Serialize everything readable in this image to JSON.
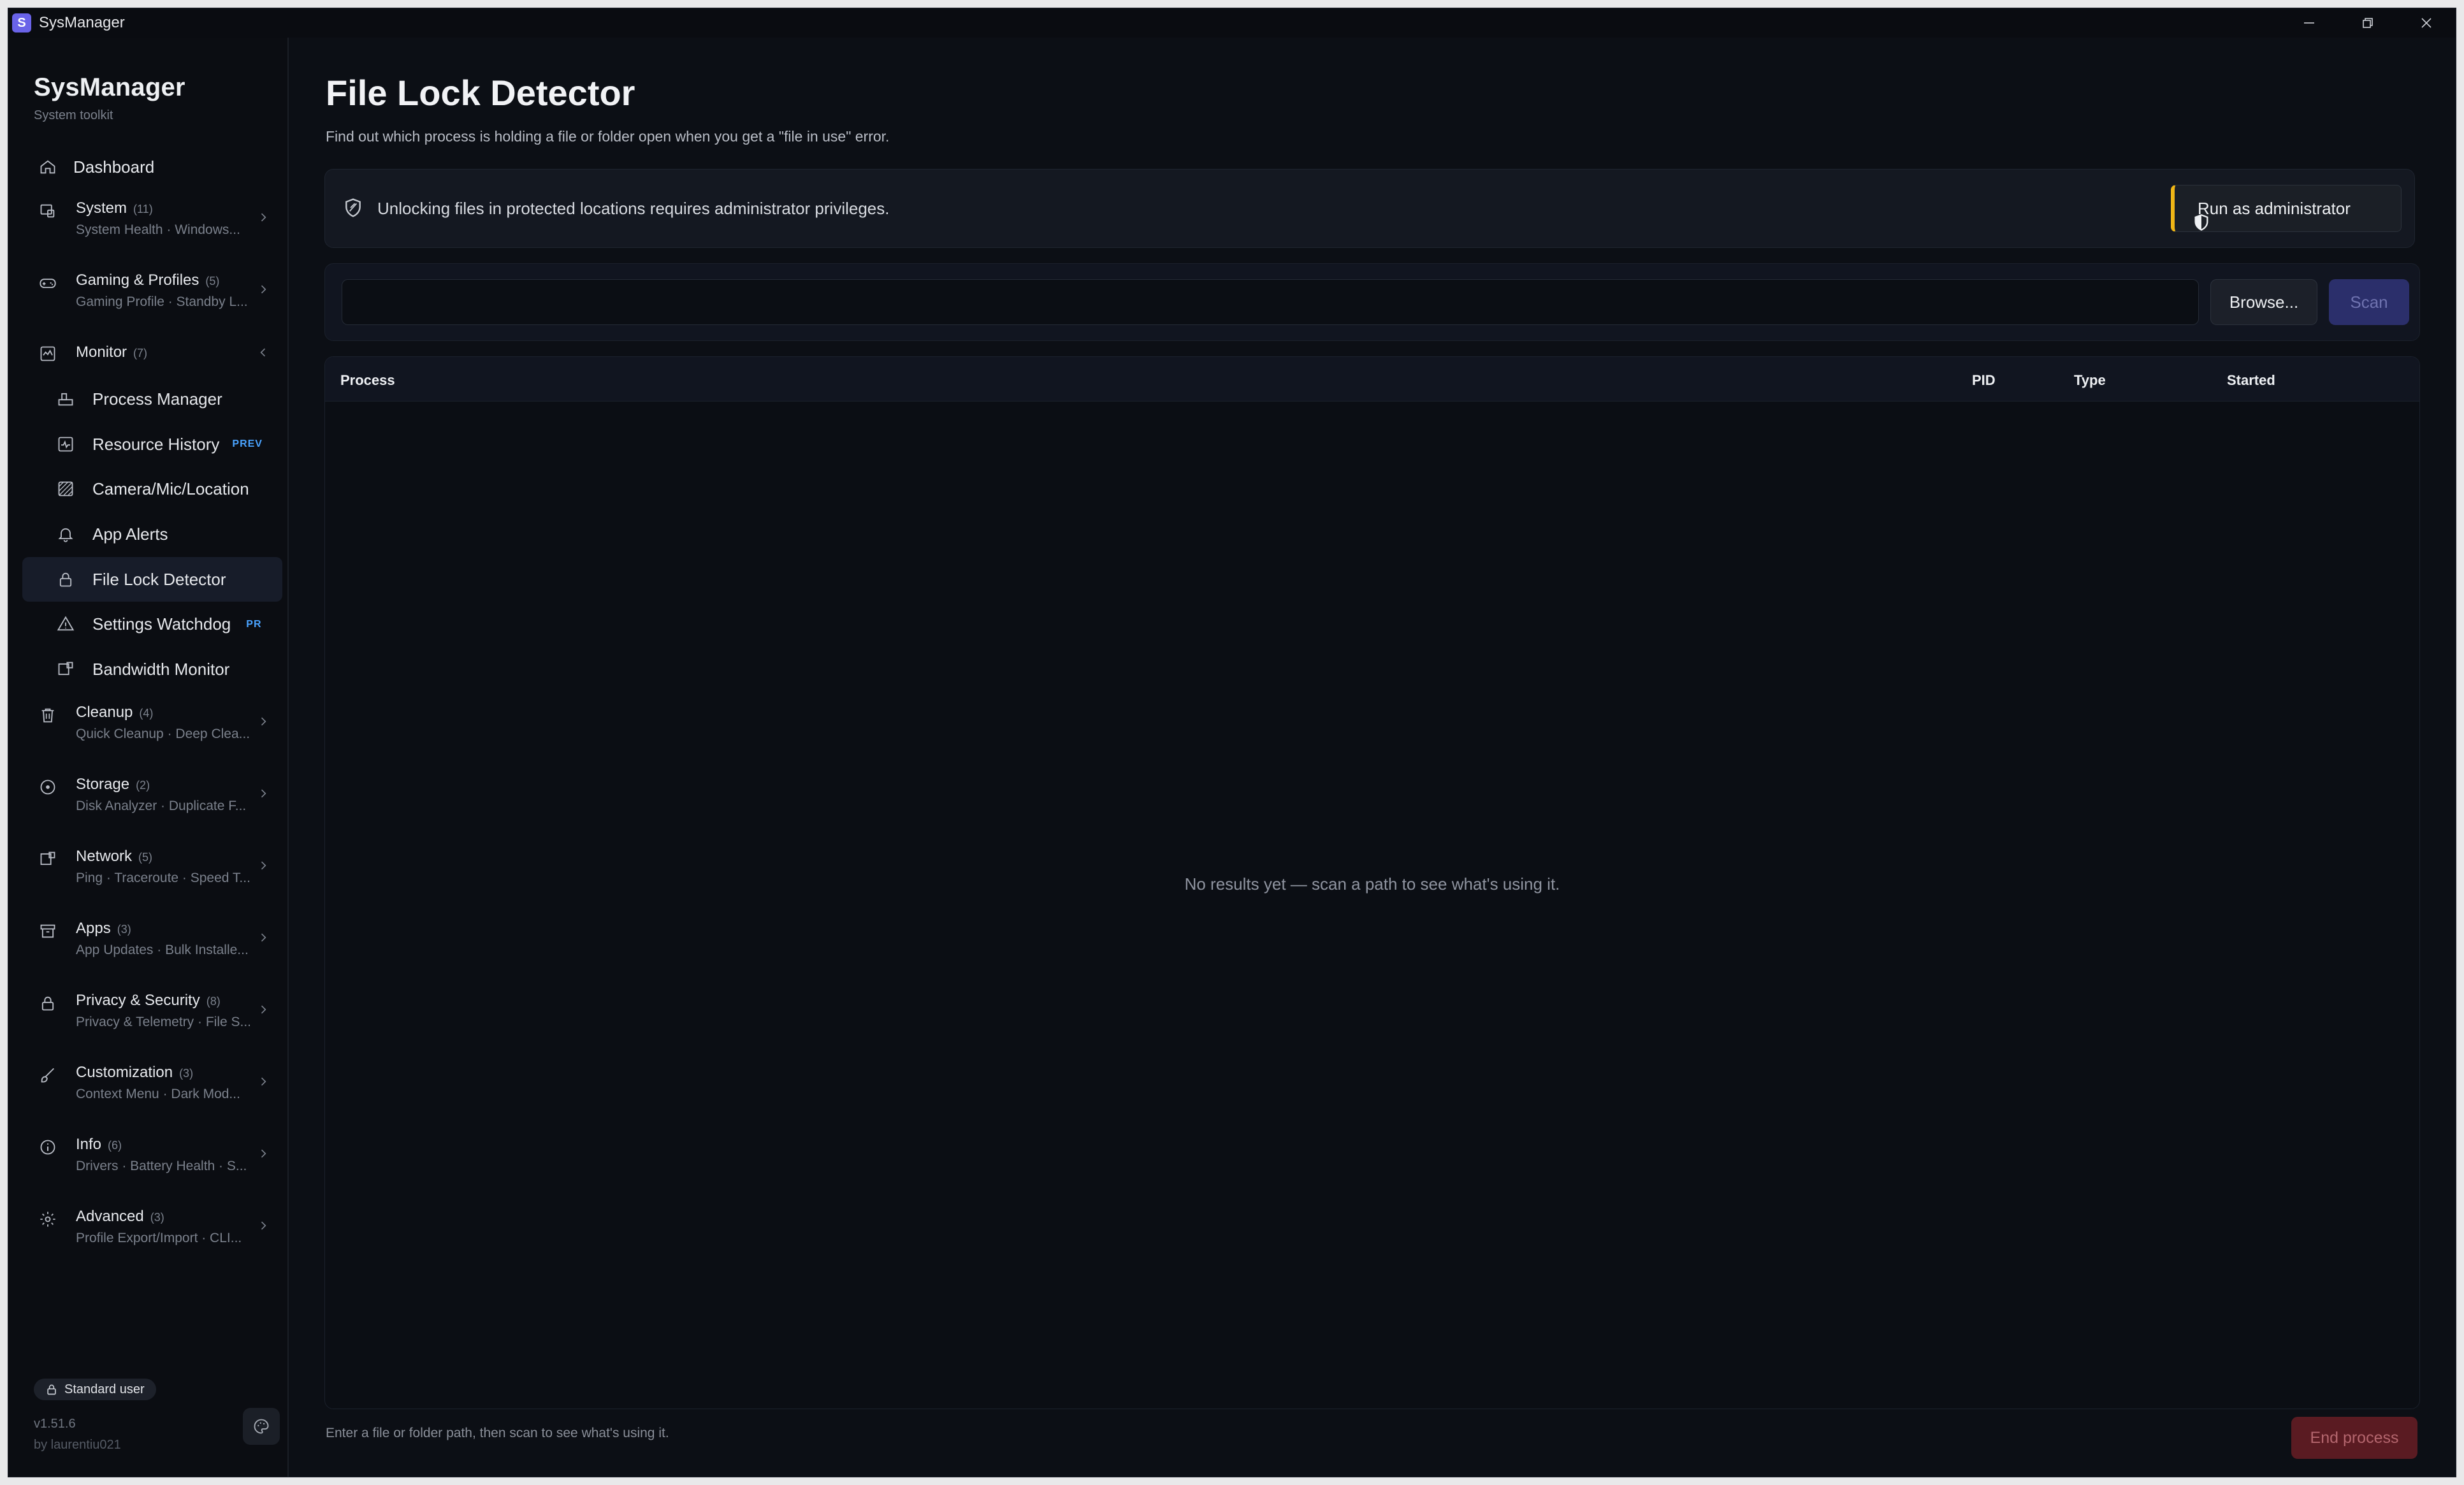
{
  "window": {
    "title": "SysManager",
    "app_icon_letter": "S"
  },
  "sidebar": {
    "brand": "SysManager",
    "brand_sub": "System toolkit",
    "dashboard": {
      "label": "Dashboard",
      "icon": "home-icon"
    },
    "groups_top": [
      {
        "title": "System",
        "count": "(11)",
        "sub": "System Health · Windows...",
        "icon": "system-icon"
      },
      {
        "title": "Gaming & Profiles",
        "count": "(5)",
        "sub": "Gaming Profile · Standby L...",
        "icon": "gamepad-icon"
      }
    ],
    "monitor": {
      "title": "Monitor",
      "count": "(7)",
      "icon": "monitor-icon",
      "items": [
        {
          "label": "Process Manager",
          "icon": "process-icon",
          "badge": ""
        },
        {
          "label": "Resource History",
          "icon": "chart-icon",
          "badge": "PREV"
        },
        {
          "label": "Camera/Mic/Location",
          "icon": "camera-icon",
          "badge": ""
        },
        {
          "label": "App Alerts",
          "icon": "bell-icon",
          "badge": ""
        },
        {
          "label": "File Lock Detector",
          "icon": "lock-icon",
          "badge": ""
        },
        {
          "label": "Settings Watchdog",
          "icon": "warning-icon",
          "badge": "PR"
        },
        {
          "label": "Bandwidth Monitor",
          "icon": "bandwidth-icon",
          "badge": ""
        }
      ]
    },
    "groups_bottom": [
      {
        "title": "Cleanup",
        "count": "(4)",
        "sub": "Quick Cleanup · Deep Clea...",
        "icon": "trash-icon"
      },
      {
        "title": "Storage",
        "count": "(2)",
        "sub": "Disk Analyzer · Duplicate F...",
        "icon": "disk-icon"
      },
      {
        "title": "Network",
        "count": "(5)",
        "sub": "Ping · Traceroute · Speed T...",
        "icon": "network-icon"
      },
      {
        "title": "Apps",
        "count": "(3)",
        "sub": "App Updates · Bulk Installe...",
        "icon": "apps-icon"
      },
      {
        "title": "Privacy & Security",
        "count": "(8)",
        "sub": "Privacy & Telemetry · File S...",
        "icon": "lock-icon"
      },
      {
        "title": "Customization",
        "count": "(3)",
        "sub": "Context Menu · Dark Mod...",
        "icon": "brush-icon"
      },
      {
        "title": "Info",
        "count": "(6)",
        "sub": "Drivers · Battery Health · S...",
        "icon": "info-icon"
      },
      {
        "title": "Advanced",
        "count": "(3)",
        "sub": "Profile Export/Import · CLI...",
        "icon": "gear-icon"
      }
    ],
    "footer": {
      "user": "Standard user",
      "version": "v1.51.6",
      "author": "by laurentiu021"
    }
  },
  "main": {
    "title": "File Lock Detector",
    "description": "Find out which process is holding a file or folder open when you get a \"file in use\" error.",
    "admin_banner": {
      "text": "Unlocking files in protected locations requires administrator privileges.",
      "button": "Run as administrator"
    },
    "scan": {
      "path_value": "",
      "path_placeholder": "",
      "browse_label": "Browse...",
      "scan_label": "Scan"
    },
    "table": {
      "columns": [
        "Process",
        "PID",
        "Type",
        "Started"
      ],
      "empty_message": "No results yet — scan a path to see what's using it."
    },
    "status": "Enter a file or folder path, then scan to see what's using it.",
    "end_process_label": "End process"
  },
  "colors": {
    "accent": "#6a63e8",
    "warning": "#f0b616",
    "danger_bg": "#5a1b22",
    "badge": "#4aa3ff"
  }
}
